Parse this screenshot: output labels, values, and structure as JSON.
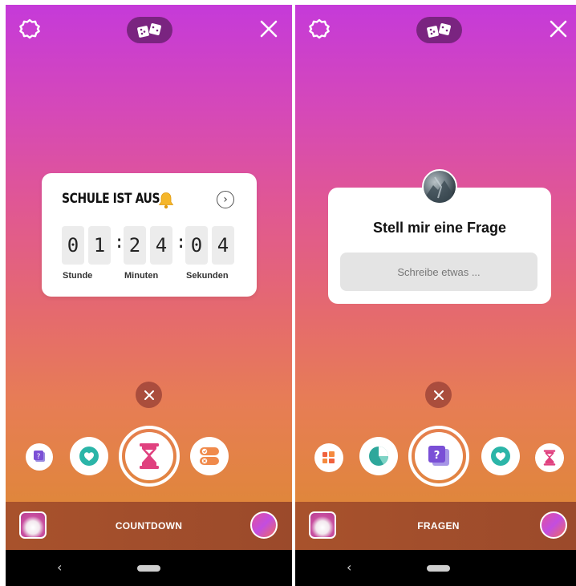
{
  "left_screen": {
    "countdown": {
      "title": "SCHULE IST AUS",
      "arrow": "›",
      "digits": [
        "0",
        "1",
        "2",
        "4",
        "0",
        "4"
      ],
      "colon": ":",
      "labels": [
        "Stunde",
        "Minuten",
        "Sekunden"
      ]
    },
    "mode_label": "COUNTDOWN",
    "tray": [
      "question-sticker-icon",
      "heart-icon",
      "hourglass-icon",
      "poll-toggle-icon"
    ]
  },
  "right_screen": {
    "fragen": {
      "title": "Stell mir eine Frage",
      "placeholder": "Schreibe etwas ..."
    },
    "mode_label": "FRAGEN",
    "tray": [
      "layout-grid-icon",
      "pie-chart-icon",
      "question-sticker-icon",
      "heart-icon",
      "hourglass-icon"
    ]
  },
  "nav": {
    "back": "‹"
  },
  "colors": {
    "gradient_top": "#c53ad9",
    "gradient_bottom": "#e0863c",
    "accent_pink": "#e0417f",
    "bottom_bar": "#a8522c"
  }
}
